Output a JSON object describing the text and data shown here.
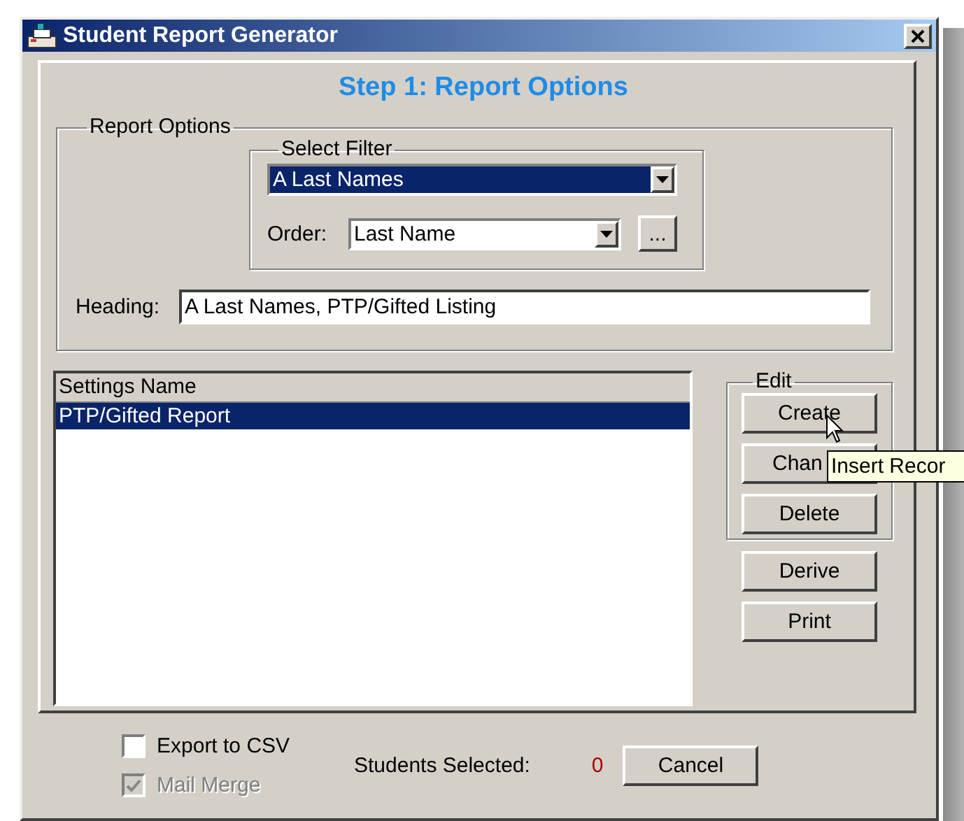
{
  "window": {
    "title": "Student Report Generator"
  },
  "step_title": "Step 1: Report Options",
  "report_options": {
    "label": "Report Options",
    "select_filter": {
      "label": "Select Filter",
      "value": "A Last Names"
    },
    "order": {
      "label": "Order:",
      "value": "Last Name",
      "browse_button": "..."
    },
    "heading": {
      "label": "Heading:",
      "value": "A Last Names, PTP/Gifted Listing"
    }
  },
  "settings_list": {
    "column": "Settings Name",
    "rows": [
      {
        "name": "PTP/Gifted Report",
        "selected": true
      }
    ]
  },
  "edit_group": {
    "label": "Edit",
    "buttons": [
      "Create",
      "Chan",
      "Delete"
    ]
  },
  "buttons": [
    "Derive",
    "Print"
  ],
  "tooltip": "Insert Recor",
  "options": [
    {
      "label": "Export to CSV",
      "checked": false,
      "disabled": false
    },
    {
      "label": "Mail Merge",
      "checked": true,
      "disabled": true
    }
  ],
  "students_selected": {
    "label": "Students Selected:",
    "value": "0"
  },
  "cancel_button": "Cancel"
}
